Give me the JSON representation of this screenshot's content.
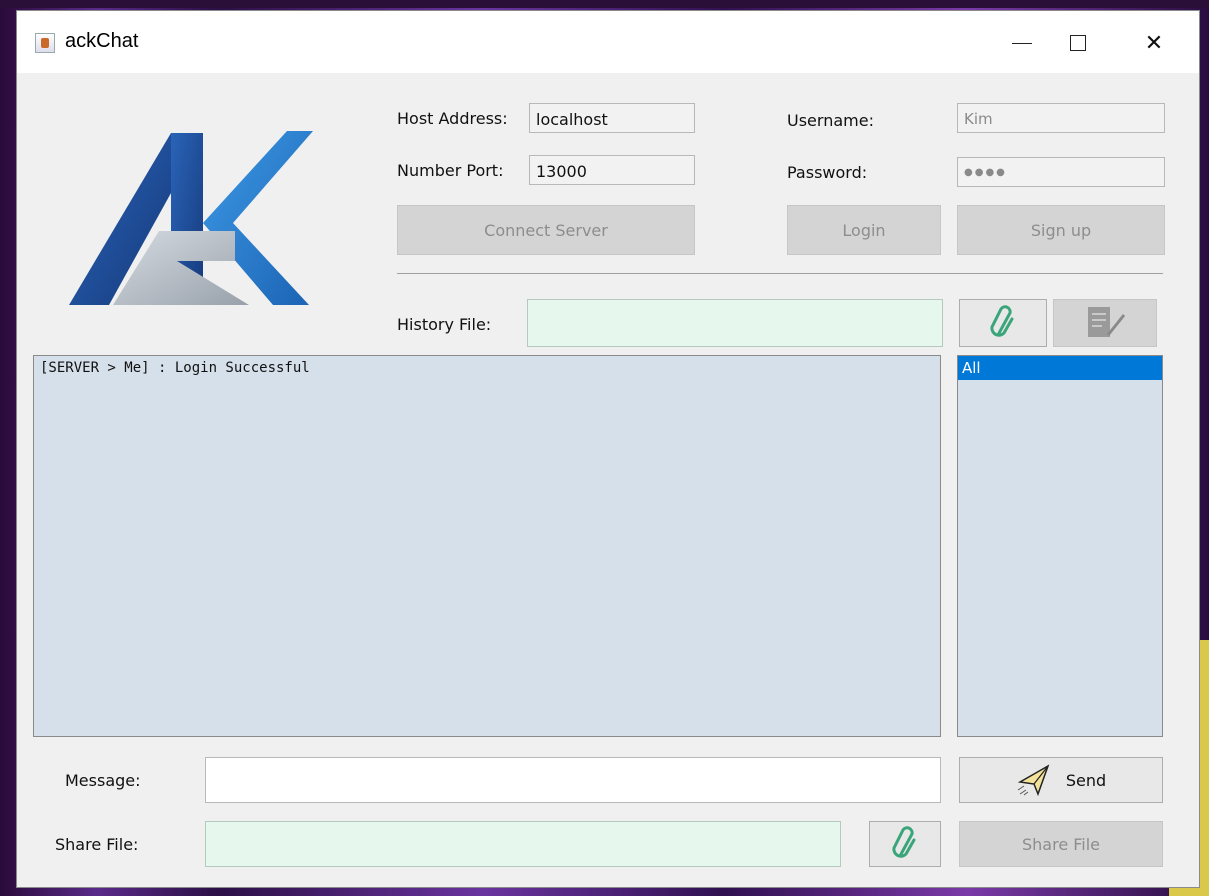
{
  "window": {
    "title": "ackChat"
  },
  "connection": {
    "host_label": "Host Address:",
    "host_value": "localhost",
    "port_label": "Number Port:",
    "port_value": "13000",
    "connect_button": "Connect Server"
  },
  "auth": {
    "username_label": "Username:",
    "username_value": "Kim",
    "password_label": "Password:",
    "password_value": "●●●●",
    "login_button": "Login",
    "signup_button": "Sign up"
  },
  "history": {
    "label": "History File:",
    "value": ""
  },
  "chat": {
    "messages": [
      "[SERVER > Me] : Login Successful"
    ]
  },
  "users": {
    "items": [
      "All"
    ]
  },
  "message": {
    "label": "Message:",
    "value": "",
    "send_button": "Send"
  },
  "share": {
    "label": "Share File:",
    "value": "",
    "share_button": "Share File"
  },
  "colors": {
    "logo_blue_dark": "#1e3f8a",
    "logo_blue_light": "#2a7fd0",
    "logo_gray": "#b5bcc4",
    "selection": "#0078d7",
    "chat_bg": "#d6e0ea",
    "file_field_bg": "#e6f7ee"
  }
}
